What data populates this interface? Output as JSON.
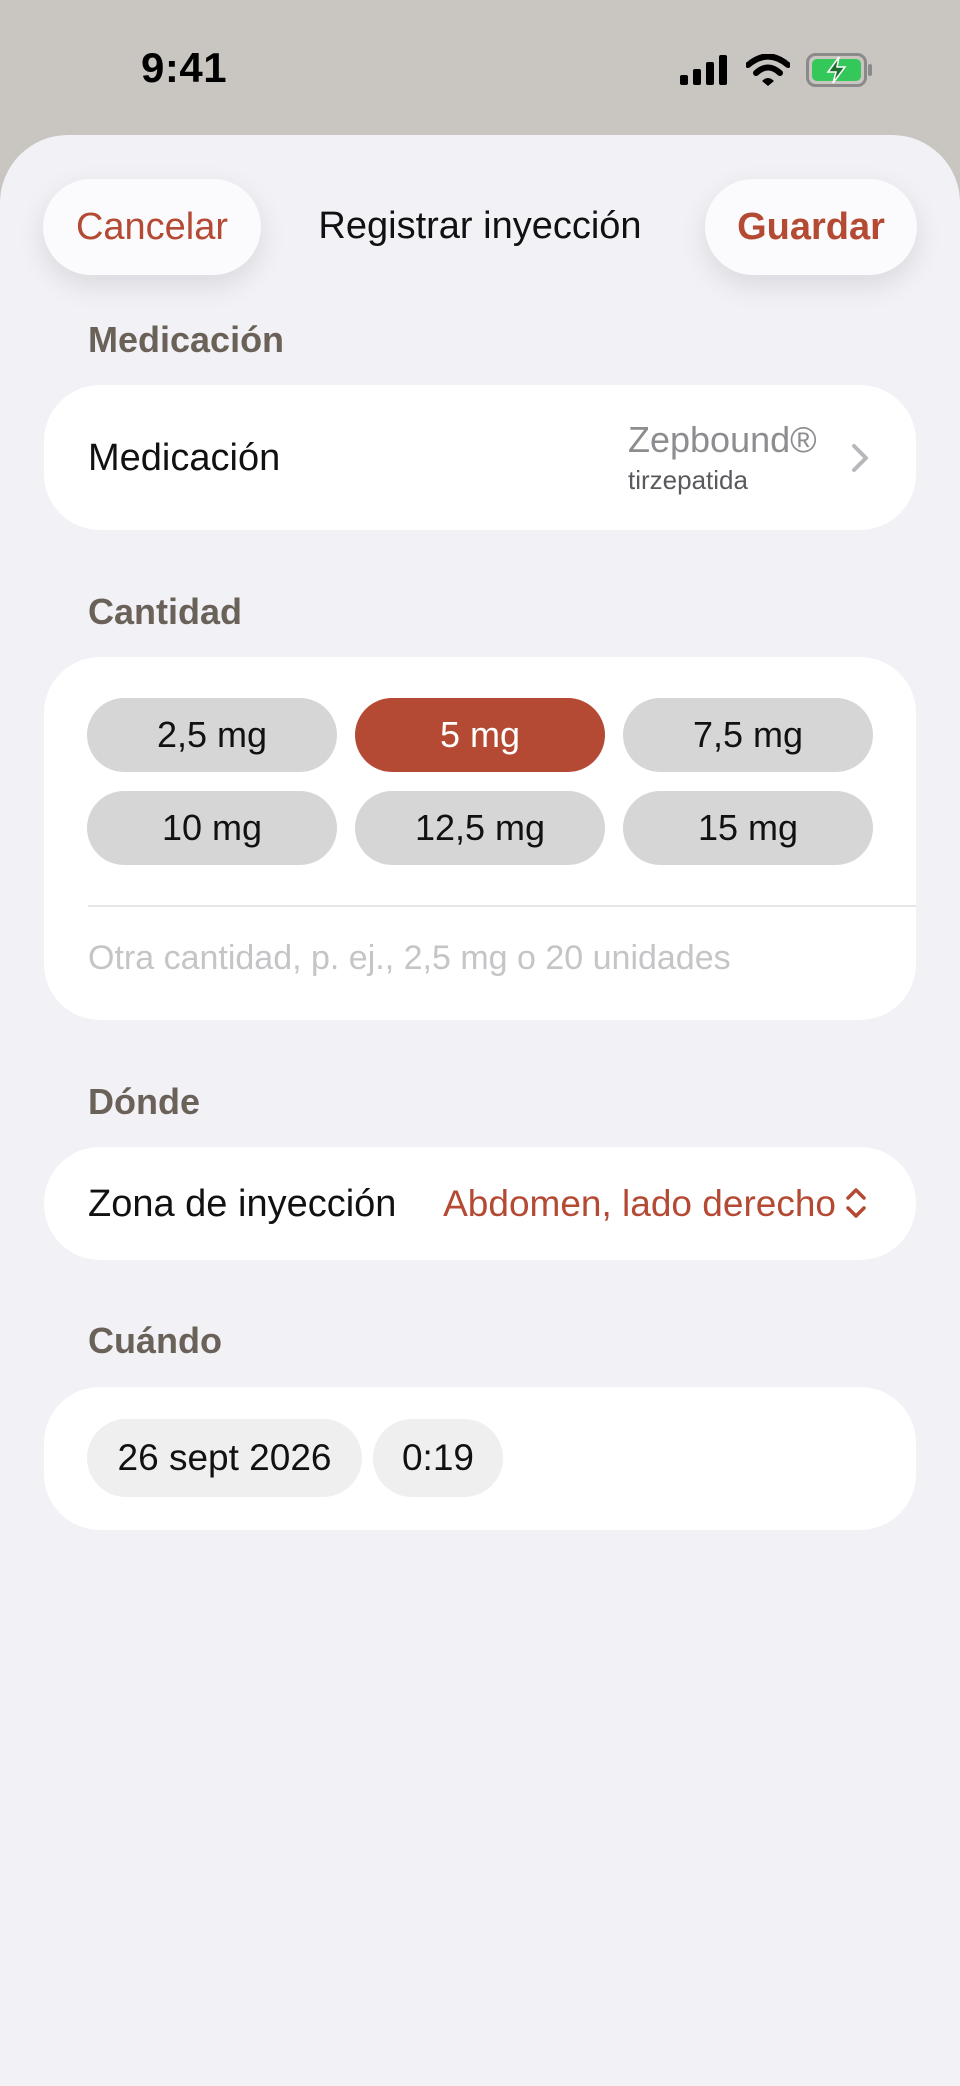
{
  "status_bar": {
    "time": "9:41"
  },
  "nav": {
    "cancel_label": "Cancelar",
    "title": "Registrar inyección",
    "save_label": "Guardar"
  },
  "medication": {
    "section_label": "Medicación",
    "row_label": "Medicación",
    "name": "Zepbound®",
    "generic": "tirzepatida"
  },
  "amount": {
    "section_label": "Cantidad",
    "options": [
      "2,5 mg",
      "5 mg",
      "7,5 mg",
      "10 mg",
      "12,5 mg",
      "15 mg"
    ],
    "selected": "5 mg",
    "placeholder": "Otra cantidad, p. ej., 2,5 mg o 20 unidades"
  },
  "where": {
    "section_label": "Dónde",
    "row_label": "Zona de inyección",
    "value": "Abdomen, lado derecho"
  },
  "when": {
    "section_label": "Cuándo",
    "date": "26 sept 2026",
    "time": "0:19"
  },
  "colors": {
    "accent": "#b44a33",
    "background": "#f2f1f6",
    "battery": "#34c759"
  }
}
